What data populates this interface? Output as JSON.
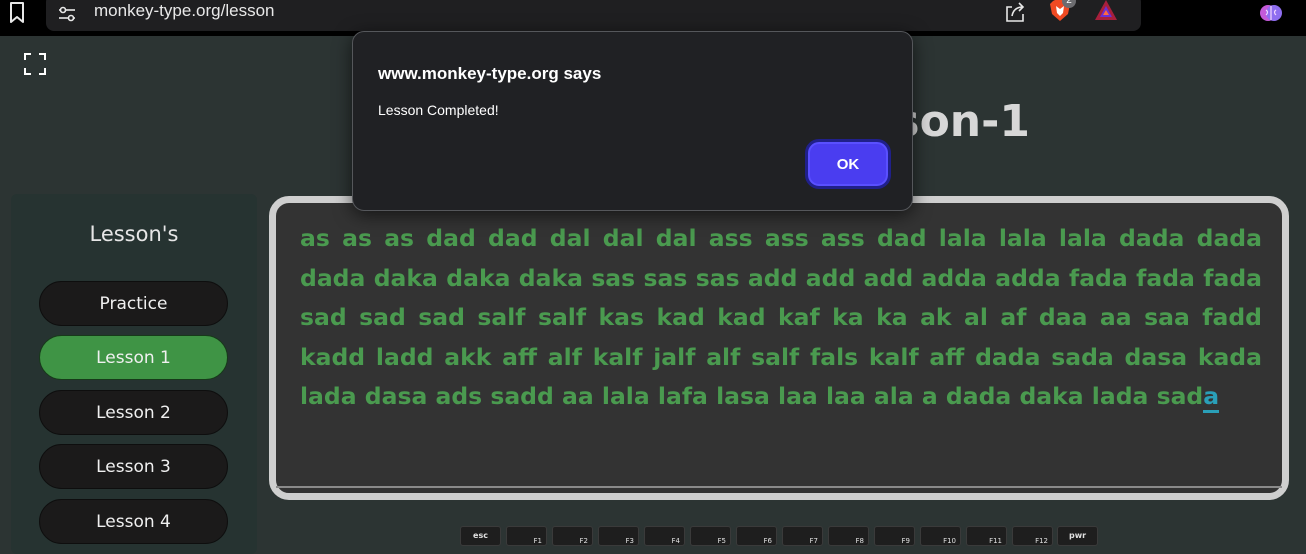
{
  "browser": {
    "url": "monkey-type.org/lesson",
    "brave_badge": "2",
    "icons": {
      "bookmark": "bookmark-icon",
      "site_info": "tune-icon",
      "share": "share-icon",
      "brave": "brave-shields-icon",
      "rewards": "brave-rewards-icon",
      "extension": "brain-extension-icon"
    }
  },
  "page": {
    "title": "Lesson-1",
    "title_visible_fragment": "son-1",
    "sidebar": {
      "title": "Lesson's",
      "items": [
        {
          "label": "Practice",
          "active": false
        },
        {
          "label": "Lesson 1",
          "active": true
        },
        {
          "label": "Lesson 2",
          "active": false
        },
        {
          "label": "Lesson 3",
          "active": false
        },
        {
          "label": "Lesson 4",
          "active": false
        }
      ]
    },
    "typing": {
      "typed_text": "as as as dad dad dal dal dal ass ass ass dad lala lala lala dada dada dada daka daka daka sas sas sas add add add adda adda fada fada fada sad sad sad salf salf kas kad kad kaf ka ka ak al af daa aa saa fadd kadd ladd akk aff alf kalf jalf alf salf fals kalf aff dada sada dasa kada lada dasa ads sadd aa lala lafa lasa laa laa ala a dada daka lada sad",
      "current_char": "a",
      "colors": {
        "typed": "#4a9a4f",
        "cursor": "#2a9fb8"
      }
    },
    "keyboard": {
      "keys": [
        "esc",
        "F1",
        "F2",
        "F3",
        "F4",
        "F5",
        "F6",
        "F7",
        "F8",
        "F9",
        "F10",
        "F11",
        "F12",
        "pwr"
      ]
    }
  },
  "dialog": {
    "title": "www.monkey-type.org says",
    "message": "Lesson Completed!",
    "ok_label": "OK",
    "accent": "#4a3df0"
  }
}
